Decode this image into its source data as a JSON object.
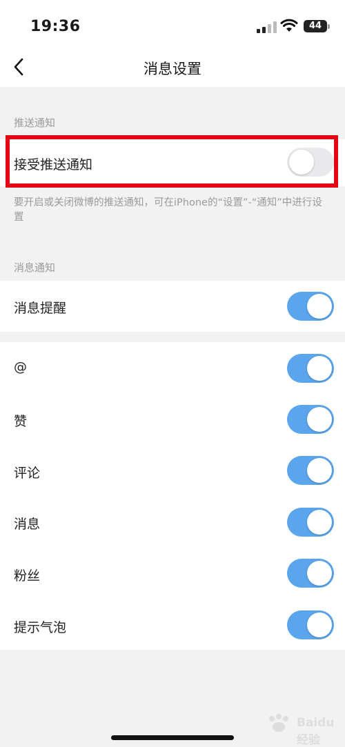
{
  "status_bar": {
    "time": "19:36",
    "battery": "44"
  },
  "nav": {
    "title": "消息设置"
  },
  "push_section": {
    "label": "推送通知",
    "accept_push": {
      "label": "接受推送通知",
      "on": false
    },
    "hint": "要开启或关闭微博的推送通知，可在iPhone的“设置”-“通知”中进行设置"
  },
  "message_section": {
    "label": "消息通知",
    "reminder": {
      "label": "消息提醒",
      "on": true
    }
  },
  "items": [
    {
      "label": "@",
      "on": true
    },
    {
      "label": "赞",
      "on": true
    },
    {
      "label": "评论",
      "on": true
    },
    {
      "label": "消息",
      "on": true
    },
    {
      "label": "粉丝",
      "on": true
    },
    {
      "label": "提示气泡",
      "on": true
    }
  ],
  "watermark": {
    "text": "Baidu经验"
  },
  "colors": {
    "toggle_on": "#5ba5ec",
    "highlight": "#e30613",
    "background": "#f2f2f2"
  }
}
